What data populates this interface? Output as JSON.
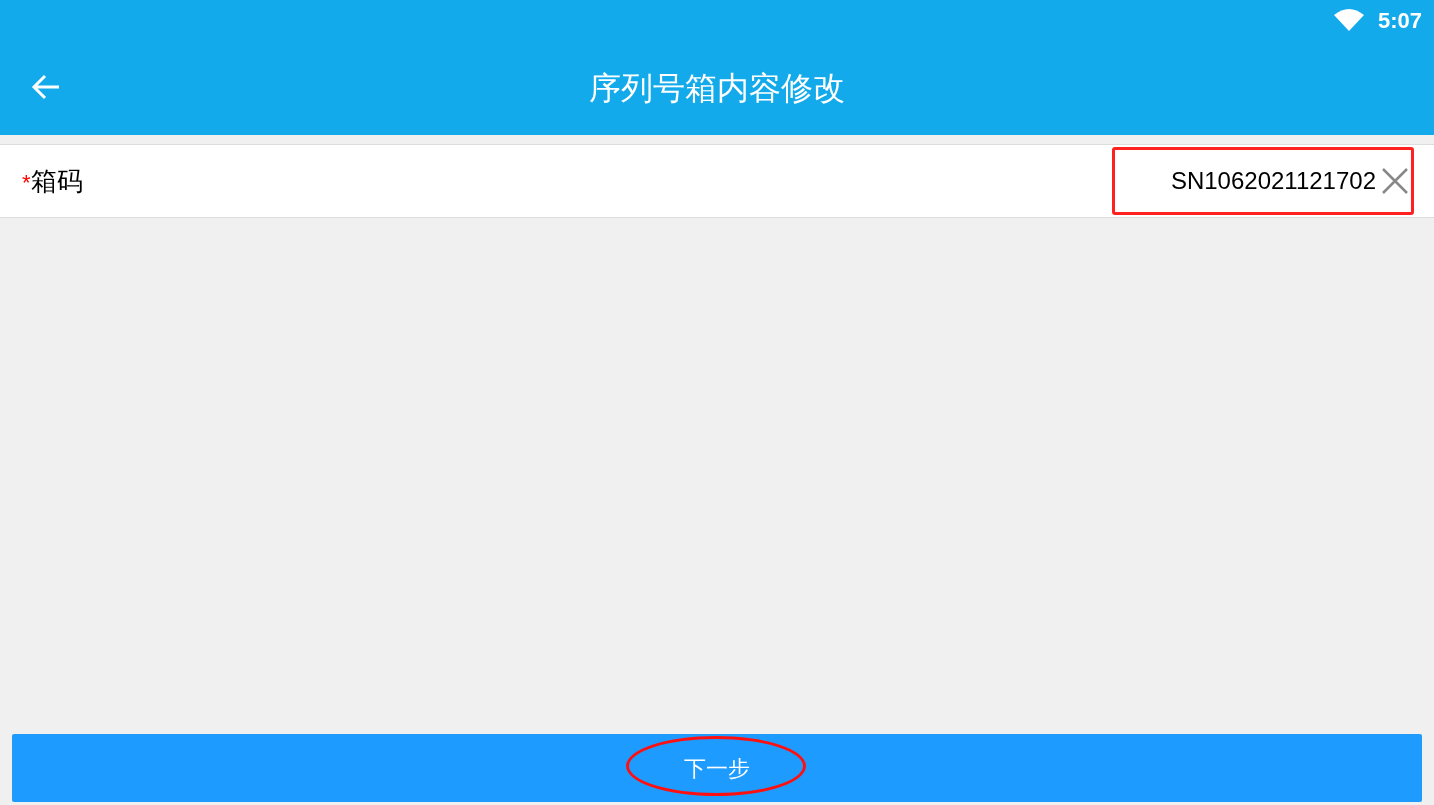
{
  "status_bar": {
    "time": "5:07"
  },
  "app_bar": {
    "title": "序列号箱内容修改"
  },
  "form": {
    "fields": [
      {
        "required_mark": "*",
        "label": "箱码",
        "value": "SN1062021121702",
        "highlighted": true
      }
    ]
  },
  "next_button": {
    "label": "下一步",
    "circled": true
  }
}
